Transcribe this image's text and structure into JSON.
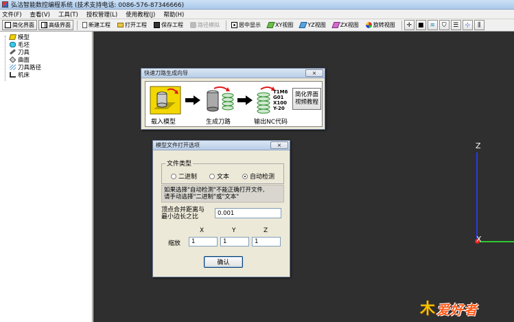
{
  "window": {
    "title": "弘沽智能数控编程系统 (技术支持电话: 0086-576-87346666)"
  },
  "menu": [
    "文件(F)",
    "查看(V)",
    "工具(T)",
    "授权管理(L)",
    "使用教程(J)",
    "帮助(H)"
  ],
  "toolbar": {
    "simple_ui": "简化界面",
    "advanced_ui": "高级界面",
    "new_project": "新建工程",
    "open_project": "打开工程",
    "save_project": "保存工程",
    "path_simulation": "路径模拟",
    "center_display": "居中显示",
    "xy_view": "XY视图",
    "yz_view": "YZ视图",
    "zx_view": "ZX视图",
    "rotate_view": "旋转视图"
  },
  "tree": {
    "items": [
      {
        "label": "模型",
        "icon": "model-icon"
      },
      {
        "label": "毛坯",
        "icon": "stock-icon"
      },
      {
        "label": "刀具",
        "icon": "tool-icon"
      },
      {
        "label": "曲面",
        "icon": "surface-icon"
      },
      {
        "label": "刀具路径",
        "icon": "toolpath-icon"
      },
      {
        "label": "机床",
        "icon": "machine-icon"
      }
    ]
  },
  "viewport": {
    "axis_z_label": "Z",
    "axis_x_label": "X",
    "colors": {
      "z_axis": "#2a3cdc",
      "x_axis": "#2ec92e",
      "origin": "#e0221d"
    }
  },
  "watermark": {
    "text": "爱好者"
  },
  "wizard": {
    "title": "快速刀路生成向导",
    "close": "×",
    "steps": [
      "载入模型",
      "生成刀路",
      "输出NC代码"
    ],
    "nc_code": [
      "T1M6",
      "G01",
      "X100",
      "Y-20"
    ],
    "tutorial_button": [
      "简化界面",
      "视频教程"
    ]
  },
  "open_options": {
    "title": "模型文件打开选项",
    "close": "×",
    "group_label": "文件类型",
    "radio_binary": "二进制",
    "radio_text": "文本",
    "radio_auto": "自动检测",
    "selected": "自动检测",
    "note_line1": "如果选择\"自动检测\"不能正确打开文件,",
    "note_line2": "请手动选择\"二进制\"或\"文本\"",
    "ratio_label_line1": "顶点合并距离与",
    "ratio_label_line2": "最小边长之比",
    "ratio_value": "0.001",
    "col_x": "X",
    "col_y": "Y",
    "col_z": "Z",
    "scale_label": "缩放",
    "scale_x": "1",
    "scale_y": "1",
    "scale_z": "1",
    "ok_button": "确认"
  }
}
